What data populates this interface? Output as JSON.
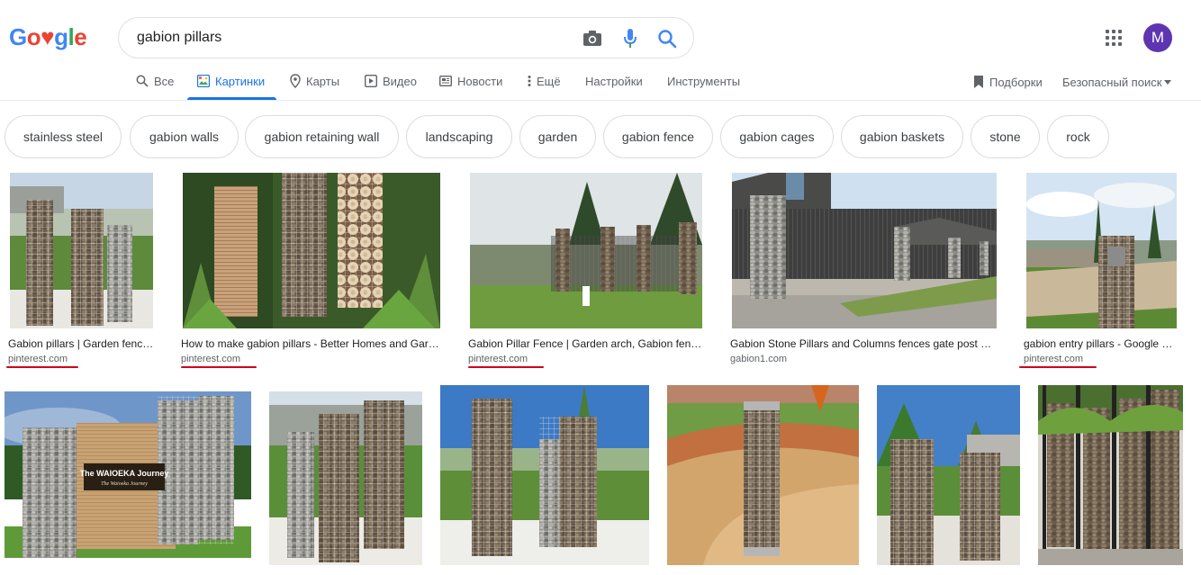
{
  "logo": {
    "letters": [
      "G",
      "o",
      "♥",
      "g",
      "l",
      "e"
    ]
  },
  "search": {
    "query": "gabion pillars"
  },
  "user": {
    "avatar_letter": "M"
  },
  "tabs": [
    {
      "label": "Все",
      "icon": "search-icon",
      "active": false
    },
    {
      "label": "Картинки",
      "icon": "image-icon",
      "active": true
    },
    {
      "label": "Карты",
      "icon": "map-pin-icon",
      "active": false
    },
    {
      "label": "Видео",
      "icon": "video-icon",
      "active": false
    },
    {
      "label": "Новости",
      "icon": "news-icon",
      "active": false
    },
    {
      "label": "Ещё",
      "icon": "more-vert-icon",
      "active": false
    },
    {
      "label": "Настройки",
      "active": false
    },
    {
      "label": "Инструменты",
      "active": false
    }
  ],
  "collections": {
    "label": "Подборки",
    "icon": "bookmark-icon"
  },
  "safe_search": {
    "label": "Безопасный поиск",
    "icon": "caret-down-icon"
  },
  "chips": [
    "stainless steel",
    "gabion walls",
    "gabion retaining wall",
    "landscaping",
    "garden",
    "gabion fence",
    "gabion cages",
    "gabion baskets",
    "stone",
    "rock"
  ],
  "results_row1": [
    {
      "caption": "Gabion pillars | Garden fenci…",
      "source": "pinterest.com",
      "underlined": true
    },
    {
      "caption": "How to make gabion pillars - Better Homes and Gar…",
      "source": "pinterest.com",
      "underlined": true
    },
    {
      "caption": "Gabion Pillar Fence | Garden arch, Gabion fenc…",
      "source": "pinterest.com",
      "underlined": true
    },
    {
      "caption": "Gabion Stone Pillars and Columns fences gate post …",
      "source": "gabion1.com",
      "underlined": false
    },
    {
      "caption": "gabion entry pillars - Google S…",
      "source": "pinterest.com",
      "underlined": true
    }
  ],
  "results_row2": [
    {
      "sign_title": "The WAIOEKA Journey",
      "sign_subtitle": "The Waioeka Journey"
    },
    {},
    {},
    {},
    {},
    {}
  ],
  "colors": {
    "accent": "#1a73e8",
    "avatar_bg": "#5e35b1",
    "underline": "#d0021b"
  }
}
